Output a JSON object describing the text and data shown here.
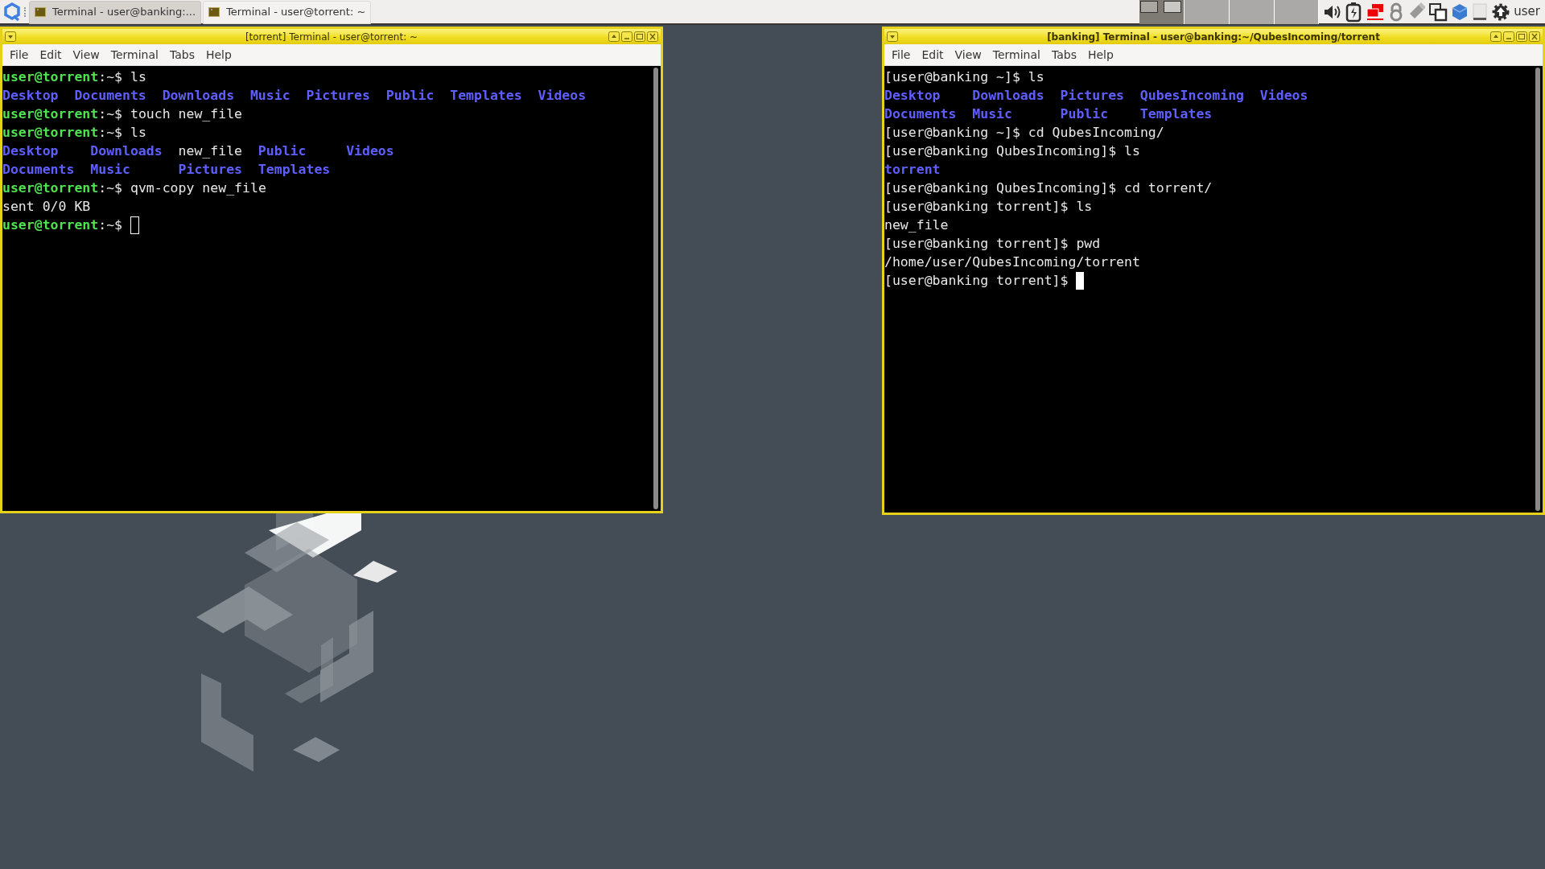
{
  "taskbar": {
    "tasks": [
      {
        "title": "Terminal - user@banking:...",
        "selected": true
      },
      {
        "title": "Terminal - user@torrent: ~",
        "selected": false
      }
    ],
    "workspaces": [
      {
        "selected": true
      },
      {
        "selected": false
      },
      {
        "selected": false
      },
      {
        "selected": false
      }
    ],
    "user": "user"
  },
  "windows": [
    {
      "title": "[torrent] Terminal - user@torrent: ~",
      "focused": false,
      "menu": [
        "File",
        "Edit",
        "View",
        "Terminal",
        "Tabs",
        "Help"
      ],
      "lines": [
        {
          "kind": "command",
          "segments": [
            {
              "text": "user@torrent",
              "kind": "prompt"
            },
            {
              "text": ":~$ ls",
              "kind": "text"
            }
          ]
        },
        {
          "kind": "listing",
          "rows": [
            [
              {
                "text": "Desktop",
                "kind": "dir"
              },
              {
                "text": "Documents",
                "kind": "dir"
              },
              {
                "text": "Downloads",
                "kind": "dir"
              },
              {
                "text": "Music",
                "kind": "dir"
              },
              {
                "text": "Pictures",
                "kind": "dir"
              },
              {
                "text": "Public",
                "kind": "dir"
              },
              {
                "text": "Templates",
                "kind": "dir"
              },
              {
                "text": "Videos",
                "kind": "dir"
              }
            ]
          ]
        },
        {
          "kind": "command",
          "segments": [
            {
              "text": "user@torrent",
              "kind": "prompt"
            },
            {
              "text": ":~$ touch new_file",
              "kind": "text"
            }
          ]
        },
        {
          "kind": "command",
          "segments": [
            {
              "text": "user@torrent",
              "kind": "prompt"
            },
            {
              "text": ":~$ ls",
              "kind": "text"
            }
          ]
        },
        {
          "kind": "listing",
          "rows": [
            [
              {
                "text": "Desktop",
                "kind": "dir"
              },
              {
                "text": "Downloads",
                "kind": "dir"
              },
              {
                "text": "new_file",
                "kind": "file"
              },
              {
                "text": "Public",
                "kind": "dir"
              },
              {
                "text": "Videos",
                "kind": "dir"
              }
            ],
            [
              {
                "text": "Documents",
                "kind": "dir"
              },
              {
                "text": "Music",
                "kind": "dir"
              },
              {
                "text": "Pictures",
                "kind": "dir"
              },
              {
                "text": "Templates",
                "kind": "dir"
              }
            ]
          ]
        },
        {
          "kind": "command",
          "segments": [
            {
              "text": "user@torrent",
              "kind": "prompt"
            },
            {
              "text": ":~$ qvm-copy new_file",
              "kind": "text"
            }
          ]
        },
        {
          "kind": "output",
          "segments": [
            {
              "text": "sent 0/0 KB",
              "kind": "text"
            }
          ]
        },
        {
          "kind": "command",
          "cursor": {
            "filled": false
          },
          "segments": [
            {
              "text": "user@torrent",
              "kind": "prompt"
            },
            {
              "text": ":~$",
              "kind": "text"
            }
          ]
        }
      ]
    },
    {
      "title": "[banking] Terminal - user@banking:~/QubesIncoming/torrent",
      "focused": true,
      "menu": [
        "File",
        "Edit",
        "View",
        "Terminal",
        "Tabs",
        "Help"
      ],
      "lines": [
        {
          "kind": "command",
          "segments": [
            {
              "text": "[user@banking ~]$ ls",
              "kind": "text"
            }
          ]
        },
        {
          "kind": "listing",
          "rows": [
            [
              {
                "text": "Desktop",
                "kind": "dir"
              },
              {
                "text": "Downloads",
                "kind": "dir"
              },
              {
                "text": "Pictures",
                "kind": "dir"
              },
              {
                "text": "QubesIncoming",
                "kind": "dir"
              },
              {
                "text": "Videos",
                "kind": "dir"
              }
            ],
            [
              {
                "text": "Documents",
                "kind": "dir"
              },
              {
                "text": "Music",
                "kind": "dir"
              },
              {
                "text": "Public",
                "kind": "dir"
              },
              {
                "text": "Templates",
                "kind": "dir"
              }
            ]
          ]
        },
        {
          "kind": "command",
          "segments": [
            {
              "text": "[user@banking ~]$ cd QubesIncoming/",
              "kind": "text"
            }
          ]
        },
        {
          "kind": "command",
          "segments": [
            {
              "text": "[user@banking QubesIncoming]$ ls",
              "kind": "text"
            }
          ]
        },
        {
          "kind": "listing",
          "rows": [
            [
              {
                "text": "torrent",
                "kind": "dir"
              }
            ]
          ]
        },
        {
          "kind": "command",
          "segments": [
            {
              "text": "[user@banking QubesIncoming]$ cd torrent/",
              "kind": "text"
            }
          ]
        },
        {
          "kind": "command",
          "segments": [
            {
              "text": "[user@banking torrent]$ ls",
              "kind": "text"
            }
          ]
        },
        {
          "kind": "listing",
          "rows": [
            [
              {
                "text": "new_file",
                "kind": "file"
              }
            ]
          ]
        },
        {
          "kind": "command",
          "segments": [
            {
              "text": "[user@banking torrent]$ pwd",
              "kind": "text"
            }
          ]
        },
        {
          "kind": "output",
          "segments": [
            {
              "text": "/home/user/QubesIncoming/torrent",
              "kind": "text"
            }
          ]
        },
        {
          "kind": "command",
          "cursor": {
            "filled": true
          },
          "segments": [
            {
              "text": "[user@banking torrent]$",
              "kind": "text"
            }
          ]
        }
      ]
    }
  ]
}
